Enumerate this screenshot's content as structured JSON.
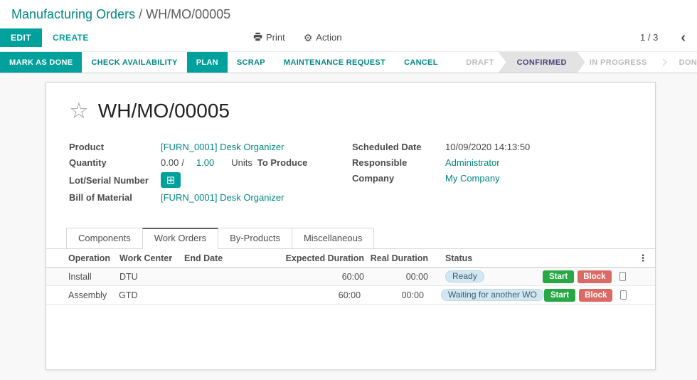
{
  "breadcrumb": {
    "parent": "Manufacturing Orders",
    "separator": " / ",
    "current": "WH/MO/00005"
  },
  "control_panel": {
    "edit_label": "EDIT",
    "create_label": "CREATE",
    "print_label": "Print",
    "action_label": "Action",
    "pager": {
      "text": "1 / 3",
      "prev_icon": "‹"
    }
  },
  "statusbar": {
    "buttons": [
      {
        "label": "MARK AS DONE",
        "style": "primary"
      },
      {
        "label": "CHECK AVAILABILITY",
        "style": "flat"
      },
      {
        "label": "PLAN",
        "style": "primary"
      },
      {
        "label": "SCRAP",
        "style": "flat"
      },
      {
        "label": "MAINTENANCE REQUEST",
        "style": "flat"
      },
      {
        "label": "CANCEL",
        "style": "flat"
      }
    ],
    "states": [
      {
        "label": "DRAFT",
        "active": false
      },
      {
        "label": "CONFIRMED",
        "active": true
      },
      {
        "label": "IN PROGRESS",
        "active": false
      },
      {
        "label": "DONE",
        "active": false
      }
    ]
  },
  "sheet": {
    "title": "WH/MO/00005",
    "fields": {
      "product": {
        "label": "Product",
        "value": "[FURN_0001] Desk Organizer"
      },
      "quantity": {
        "label": "Quantity",
        "produced": "0.00",
        "separator": "/",
        "to_produce": "1.00",
        "uom": "Units",
        "suffix": "To Produce"
      },
      "lot": {
        "label": "Lot/Serial Number",
        "button_icon": "⊞"
      },
      "bom": {
        "label": "Bill of Material",
        "value": "[FURN_0001] Desk Organizer"
      },
      "scheduled_date": {
        "label": "Scheduled Date",
        "value": "10/09/2020 14:13:50"
      },
      "responsible": {
        "label": "Responsible",
        "value": "Administrator"
      },
      "company": {
        "label": "Company",
        "value": "My Company"
      }
    },
    "tabs": [
      {
        "label": "Components",
        "active": false
      },
      {
        "label": "Work Orders",
        "active": true
      },
      {
        "label": "By-Products",
        "active": false
      },
      {
        "label": "Miscellaneous",
        "active": false
      }
    ],
    "work_orders": {
      "columns": [
        "Operation",
        "Work Center",
        "End Date",
        "Expected Duration",
        "Real Duration",
        "Status"
      ],
      "options_icon": "⋮",
      "rows": [
        {
          "operation": "Install",
          "work_center": "DTU",
          "end_date": "",
          "expected_duration": "60:00",
          "real_duration": "00:00",
          "status": "Ready"
        },
        {
          "operation": "Assembly",
          "work_center": "GTD",
          "end_date": "",
          "expected_duration": "60:00",
          "real_duration": "00:00",
          "status": "Waiting for another WO"
        }
      ],
      "row_actions": {
        "start": "Start",
        "block": "Block"
      }
    }
  },
  "colors": {
    "accent_teal": "#00a09d",
    "link_teal": "#008784",
    "state_active_text": "#4c4178",
    "state_active_bg": "#e3e3e3",
    "status_pill_bg": "#d3e7f2",
    "start_button_green": "#28a745",
    "block_button_red": "#dc6a64"
  }
}
